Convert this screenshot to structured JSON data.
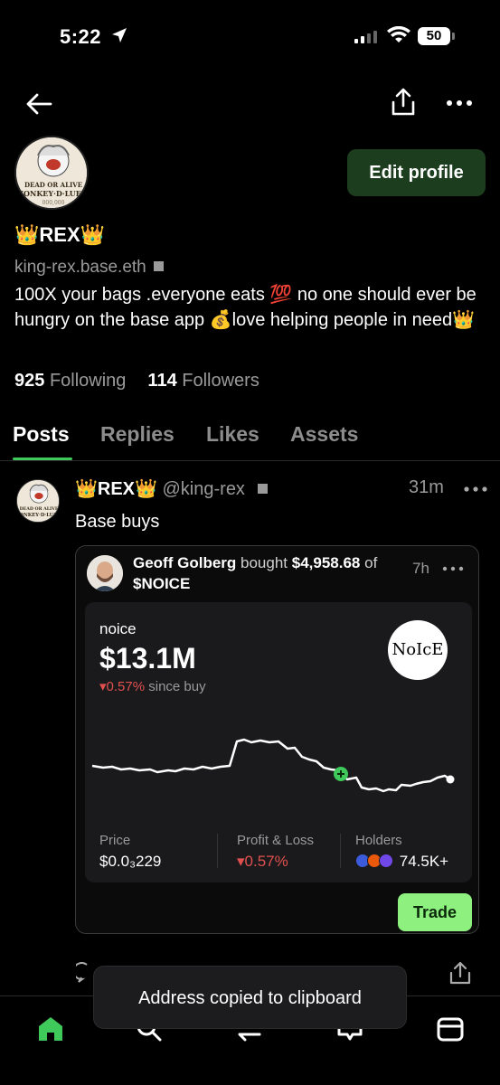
{
  "status_bar": {
    "time": "5:22",
    "battery": "50"
  },
  "profile": {
    "name": "👑REX👑",
    "handle": "king-rex.base.eth",
    "bio": "100X your bags .everyone eats 💯 no one should ever be hungry on the base app 💰love helping people in need👑",
    "following_count": "925",
    "following_label": "Following",
    "followers_count": "114",
    "followers_label": "Followers",
    "edit_label": "Edit profile"
  },
  "tabs": [
    "Posts",
    "Replies",
    "Likes",
    "Assets"
  ],
  "post": {
    "author": "👑REX👑",
    "handle": "@king-rex",
    "time": "31m",
    "text": "Base buys",
    "embed": {
      "buyer": "Geoff Golberg",
      "verb": "bought",
      "amount": "$4,958.68",
      "of": "of",
      "token": "$NOICE",
      "time": "7h",
      "coin_name": "noice",
      "market_cap": "$13.1M",
      "change": "▾0.57%",
      "change_suffix": "since buy",
      "logo_text": "NoIcE",
      "stats": {
        "price_label": "Price",
        "price_value": "$0.0₃229",
        "pnl_label": "Profit & Loss",
        "pnl_value": "▾0.57%",
        "holders_label": "Holders",
        "holders_value": "74.5K+"
      },
      "trade_label": "Trade"
    }
  },
  "toast": "Address copied to clipboard",
  "colors": {
    "accent_green": "#3ec95a",
    "trade_green": "#8df07f",
    "negative": "#e0504f",
    "edit_bg": "#1c3d1e"
  }
}
